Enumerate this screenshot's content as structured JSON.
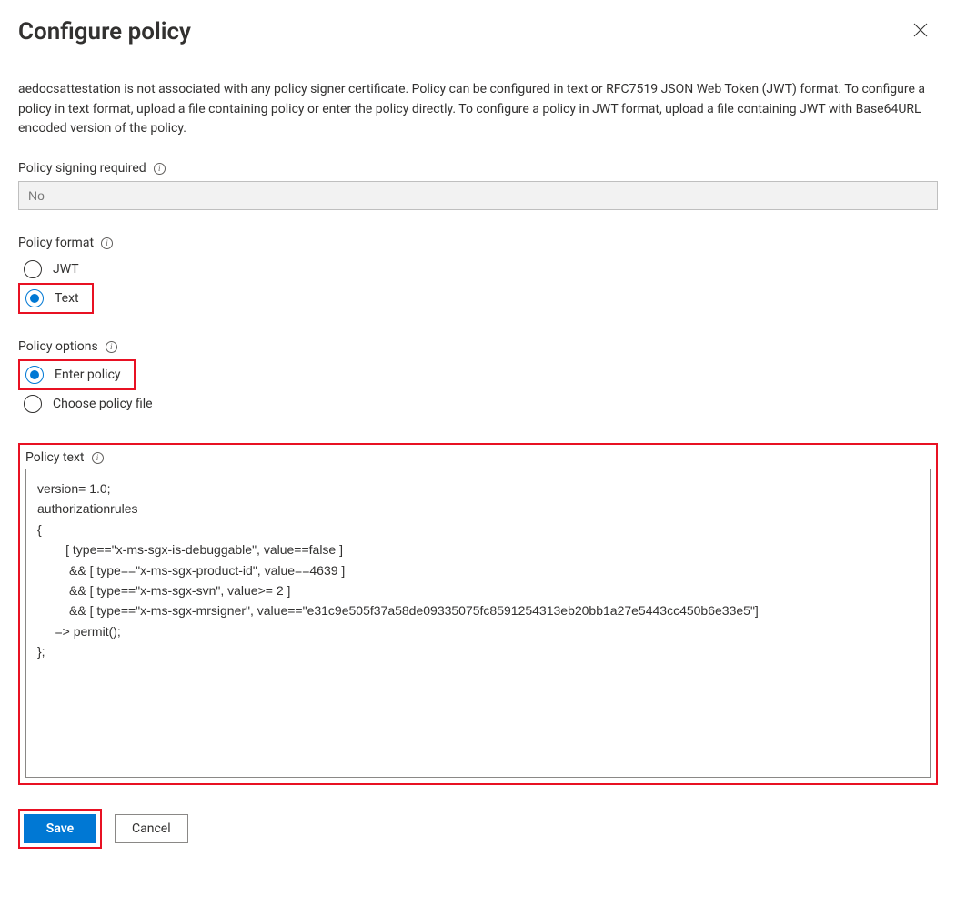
{
  "title": "Configure policy",
  "description": "aedocsattestation is not associated with any policy signer certificate. Policy can be configured in text or RFC7519 JSON Web Token (JWT) format. To configure a policy in text format, upload a file containing policy or enter the policy directly. To configure a policy in JWT format, upload a file containing JWT with Base64URL encoded version of the policy.",
  "signing": {
    "label": "Policy signing required",
    "value": "No"
  },
  "format": {
    "label": "Policy format",
    "options": {
      "jwt": "JWT",
      "text": "Text"
    },
    "selected": "text"
  },
  "options": {
    "label": "Policy options",
    "enter": "Enter policy",
    "file": "Choose policy file",
    "selected": "enter"
  },
  "policy_text": {
    "label": "Policy text",
    "value": "version= 1.0;\nauthorizationrules\n{\n        [ type==\"x-ms-sgx-is-debuggable\", value==false ]\n         && [ type==\"x-ms-sgx-product-id\", value==4639 ]\n         && [ type==\"x-ms-sgx-svn\", value>= 2 ]\n         && [ type==\"x-ms-sgx-mrsigner\", value==\"e31c9e505f37a58de09335075fc8591254313eb20bb1a27e5443cc450b6e33e5\"]\n     => permit();\n};"
  },
  "buttons": {
    "save": "Save",
    "cancel": "Cancel"
  }
}
